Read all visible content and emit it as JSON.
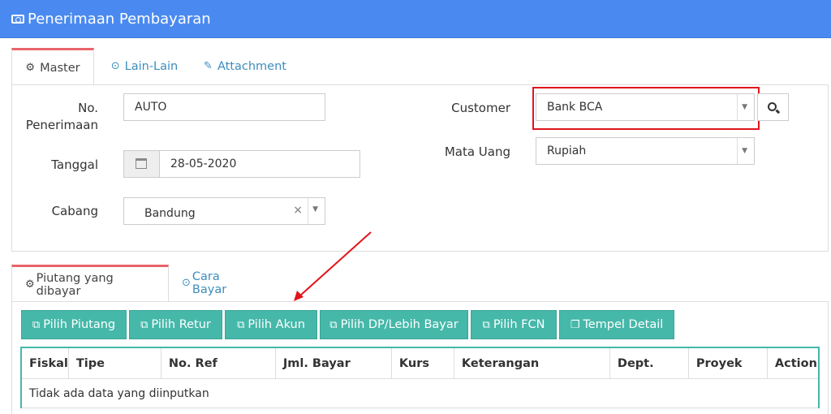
{
  "header": {
    "title": "Penerimaan Pembayaran",
    "icon": "money-icon"
  },
  "tabs_top": [
    {
      "label": "Master",
      "icon": "cogs-icon",
      "active": true
    },
    {
      "label": "Lain-Lain",
      "icon": "check-circle-icon",
      "active": false
    },
    {
      "label": "Attachment",
      "icon": "paperclip-icon",
      "active": false
    }
  ],
  "form": {
    "no_label_1": "No.",
    "no_label_2": "Penerimaan",
    "no_value": "AUTO",
    "tanggal_label": "Tanggal",
    "tanggal_value": "28-05-2020",
    "cabang_label": "Cabang",
    "cabang_value": "Bandung",
    "customer_label": "Customer",
    "customer_value": "Bank BCA",
    "mata_uang_label": "Mata Uang",
    "mata_uang_value": "Rupiah"
  },
  "tabs_bottom": [
    {
      "label": "Piutang yang dibayar",
      "icon": "cogs-icon",
      "active": true
    },
    {
      "label": "Cara Bayar",
      "icon": "check-circle-icon",
      "active": false
    }
  ],
  "buttons": [
    {
      "label": "Pilih Piutang"
    },
    {
      "label": "Pilih Retur"
    },
    {
      "label": "Pilih Akun"
    },
    {
      "label": "Pilih DP/Lebih Bayar"
    },
    {
      "label": "Pilih FCN"
    },
    {
      "label": "Tempel Detail"
    }
  ],
  "table": {
    "columns": [
      "Fiskal",
      "Tipe",
      "No. Ref",
      "Jml. Bayar",
      "Kurs",
      "Keterangan",
      "Dept.",
      "Proyek",
      "Action"
    ],
    "empty_text": "Tidak ada data yang diinputkan"
  },
  "colors": {
    "header": "#4a8af0",
    "button": "#45b8a9",
    "tab_accent": "#e8646a",
    "highlight": "#e0161b"
  }
}
